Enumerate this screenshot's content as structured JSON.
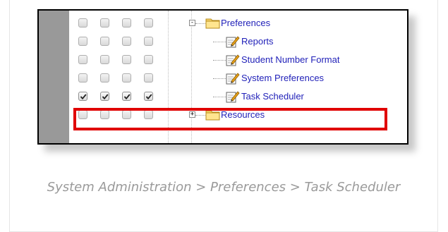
{
  "tree": {
    "rows": [
      {
        "label": "Preferences",
        "icon": "folder-icon",
        "expander": "-",
        "checked": [
          false,
          false,
          false,
          false
        ]
      },
      {
        "label": "Reports",
        "icon": "tool-document-icon",
        "checked": [
          false,
          false,
          false,
          false
        ]
      },
      {
        "label": "Student Number Format",
        "icon": "tool-document-icon",
        "checked": [
          false,
          false,
          false,
          false
        ]
      },
      {
        "label": "System Preferences",
        "icon": "tool-document-icon",
        "checked": [
          false,
          false,
          false,
          false
        ]
      },
      {
        "label": "Task Scheduler",
        "icon": "tool-document-icon",
        "checked": [
          true,
          true,
          true,
          true
        ],
        "highlighted": true
      },
      {
        "label": "Resources",
        "icon": "folder-icon",
        "expander": "+",
        "checked": [
          false,
          false,
          false,
          false
        ]
      }
    ]
  },
  "caption": "System Administration > Preferences > Task Scheduler",
  "colors": {
    "link": "#1f1fb8",
    "highlight": "#e00000",
    "caption": "#9a9a9a"
  }
}
